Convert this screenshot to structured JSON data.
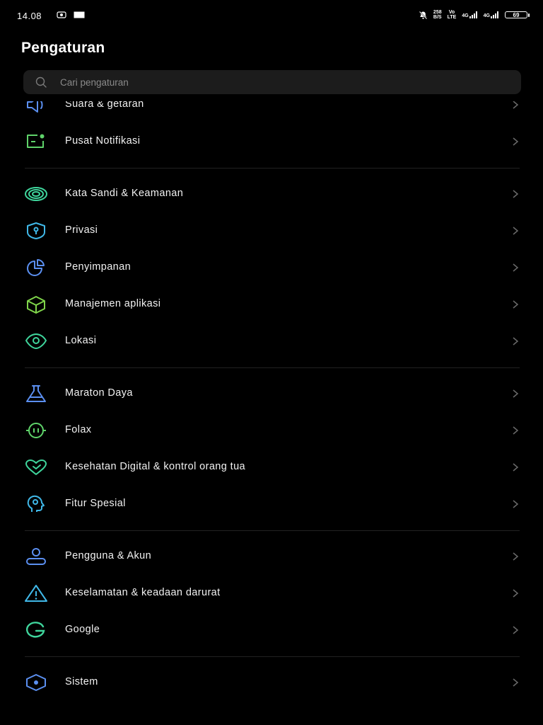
{
  "status_bar": {
    "time": "14.08",
    "net_speed_top": "258",
    "net_speed_bottom": "B/S",
    "volte_top": "Vo",
    "volte_bottom": "LTE",
    "signal1": "4G",
    "signal2": "4G",
    "battery": "69"
  },
  "header": {
    "title": "Pengaturan"
  },
  "search": {
    "placeholder": "Cari pengaturan"
  },
  "items": [
    {
      "label": "Suara & getaran",
      "icon": "speaker-icon",
      "color": "#5b8ff0"
    },
    {
      "label": "Pusat Notifikasi",
      "icon": "notification-icon",
      "color": "#5fd36a"
    },
    {
      "label": "Kata Sandi & Keamanan",
      "icon": "fingerprint-icon",
      "color": "#3fd59c"
    },
    {
      "label": "Privasi",
      "icon": "shield-lock-icon",
      "color": "#40b8e8"
    },
    {
      "label": "Penyimpanan",
      "icon": "pie-chart-icon",
      "color": "#5b8ff0"
    },
    {
      "label": "Manajemen aplikasi",
      "icon": "cube-icon",
      "color": "#7fd44a"
    },
    {
      "label": "Lokasi",
      "icon": "eye-location-icon",
      "color": "#3fd59c"
    },
    {
      "label": "Maraton Daya",
      "icon": "flask-icon",
      "color": "#5b8ff0"
    },
    {
      "label": "Folax",
      "icon": "folax-icon",
      "color": "#5fd36a"
    },
    {
      "label": "Kesehatan Digital & kontrol orang tua",
      "icon": "heart-check-icon",
      "color": "#3fd59c"
    },
    {
      "label": "Fitur Spesial",
      "icon": "head-icon",
      "color": "#40b8e8"
    },
    {
      "label": "Pengguna & Akun",
      "icon": "user-icon",
      "color": "#5b8ff0"
    },
    {
      "label": "Keselamatan & keadaan darurat",
      "icon": "warning-icon",
      "color": "#40b8e8"
    },
    {
      "label": "Google",
      "icon": "google-icon",
      "color": "#3fd59c"
    },
    {
      "label": "Sistem",
      "icon": "hexagon-icon",
      "color": "#5b8ff0"
    }
  ]
}
